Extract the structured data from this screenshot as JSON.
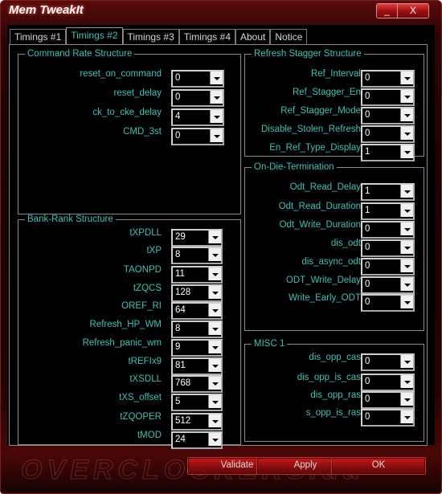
{
  "window": {
    "title": "Mem TweakIt",
    "minimize_label": "_",
    "close_label": "X"
  },
  "tabs": [
    {
      "label": "Timings #1",
      "active": false
    },
    {
      "label": "Timings #2",
      "active": true
    },
    {
      "label": "Timings #3",
      "active": false
    },
    {
      "label": "Timings #4",
      "active": false
    },
    {
      "label": "About",
      "active": false
    },
    {
      "label": "Notice",
      "active": false
    }
  ],
  "groups": {
    "command_rate": {
      "title": "Command Rate Structure",
      "fields": [
        {
          "label": "reset_on_command",
          "value": "0"
        },
        {
          "label": "reset_delay",
          "value": "0"
        },
        {
          "label": "ck_to_cke_delay",
          "value": "4"
        },
        {
          "label": "CMD_3st",
          "value": "0"
        }
      ]
    },
    "bank_rank": {
      "title": "Bank-Rank Structure",
      "fields": [
        {
          "label": "tXPDLL",
          "value": "29"
        },
        {
          "label": "tXP",
          "value": "8"
        },
        {
          "label": "TAONPD",
          "value": "11"
        },
        {
          "label": "tZQCS",
          "value": "128"
        },
        {
          "label": "OREF_RI",
          "value": "64"
        },
        {
          "label": "Refresh_HP_WM",
          "value": "8"
        },
        {
          "label": "Refresh_panic_wm",
          "value": "9"
        },
        {
          "label": "tREFIx9",
          "value": "81"
        },
        {
          "label": "tXSDLL",
          "value": "768"
        },
        {
          "label": "tXS_offset",
          "value": "5"
        },
        {
          "label": "tZQOPER",
          "value": "512"
        },
        {
          "label": "tMOD",
          "value": "24"
        }
      ]
    },
    "refresh_stagger": {
      "title": "Refresh Stagger Structure",
      "fields": [
        {
          "label": "Ref_Interval",
          "value": "0"
        },
        {
          "label": "Ref_Stagger_En",
          "value": "0"
        },
        {
          "label": "Ref_Stagger_Mode",
          "value": "0"
        },
        {
          "label": "Disable_Stolen_Refresh",
          "value": "0"
        },
        {
          "label": "En_Ref_Type_Display",
          "value": "1"
        }
      ]
    },
    "odt": {
      "title": "On-Die-Termination",
      "fields": [
        {
          "label": "Odt_Read_Delay",
          "value": "1"
        },
        {
          "label": "Odt_Read_Duration",
          "value": "1"
        },
        {
          "label": "Odt_Write_Duration",
          "value": "0"
        },
        {
          "label": "dis_odt",
          "value": "0"
        },
        {
          "label": "dis_async_odt",
          "value": "0"
        },
        {
          "label": "ODT_Write_Delay",
          "value": "0"
        },
        {
          "label": "Write_Early_ODT",
          "value": "0"
        }
      ]
    },
    "misc1": {
      "title": "MISC 1",
      "fields": [
        {
          "label": "dis_opp_cas",
          "value": "0"
        },
        {
          "label": "dis_opp_is_cas",
          "value": "0"
        },
        {
          "label": "dis_opp_ras",
          "value": "0"
        },
        {
          "label": "s_opp_is_ras",
          "value": "0"
        }
      ]
    }
  },
  "buttons": {
    "validate": "Validate",
    "apply": "Apply",
    "ok": "OK"
  },
  "watermark": "OVERCLOCKERS.ua"
}
